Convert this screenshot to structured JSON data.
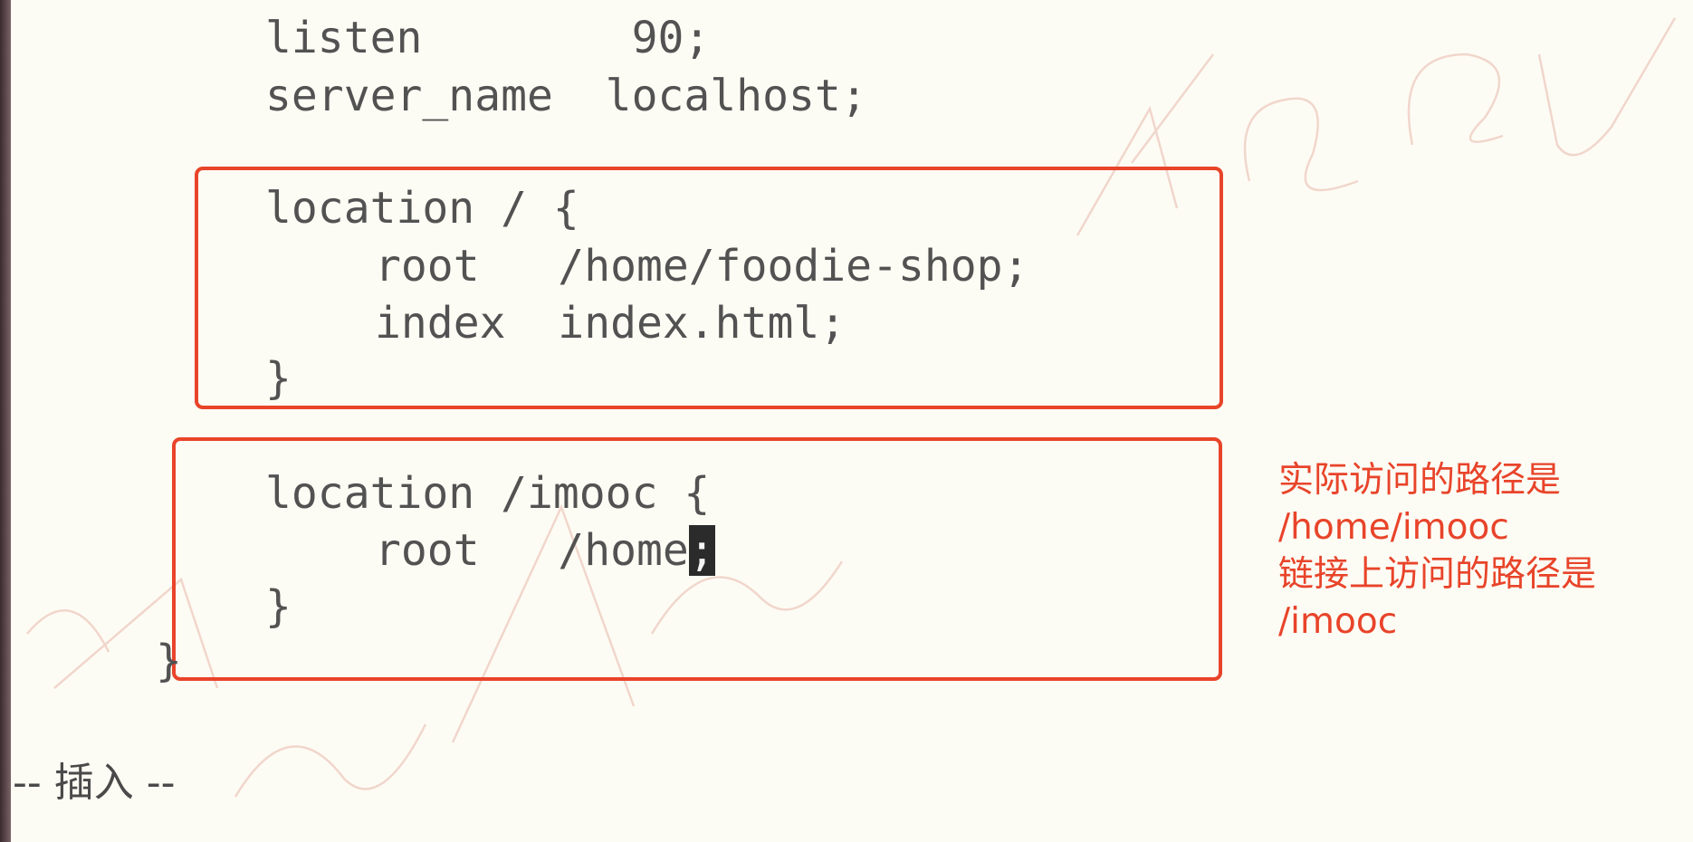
{
  "editor": {
    "lines": [
      "listen        90;",
      "server_name  localhost;",
      "location / {",
      "root   /home/foodie-shop;",
      "index  index.html;",
      "}",
      "location /imooc {",
      "root   /home",
      ";",
      "}",
      "}"
    ]
  },
  "annotation": {
    "lines": [
      "实际访问的路径是",
      "/home/imooc",
      "链接上访问的路径是",
      "/imooc"
    ]
  },
  "status_bar": {
    "mode": "-- 插入 --"
  },
  "colors": {
    "highlight": "#e8442a",
    "text": "#525252",
    "background": "#fdfcf4"
  }
}
